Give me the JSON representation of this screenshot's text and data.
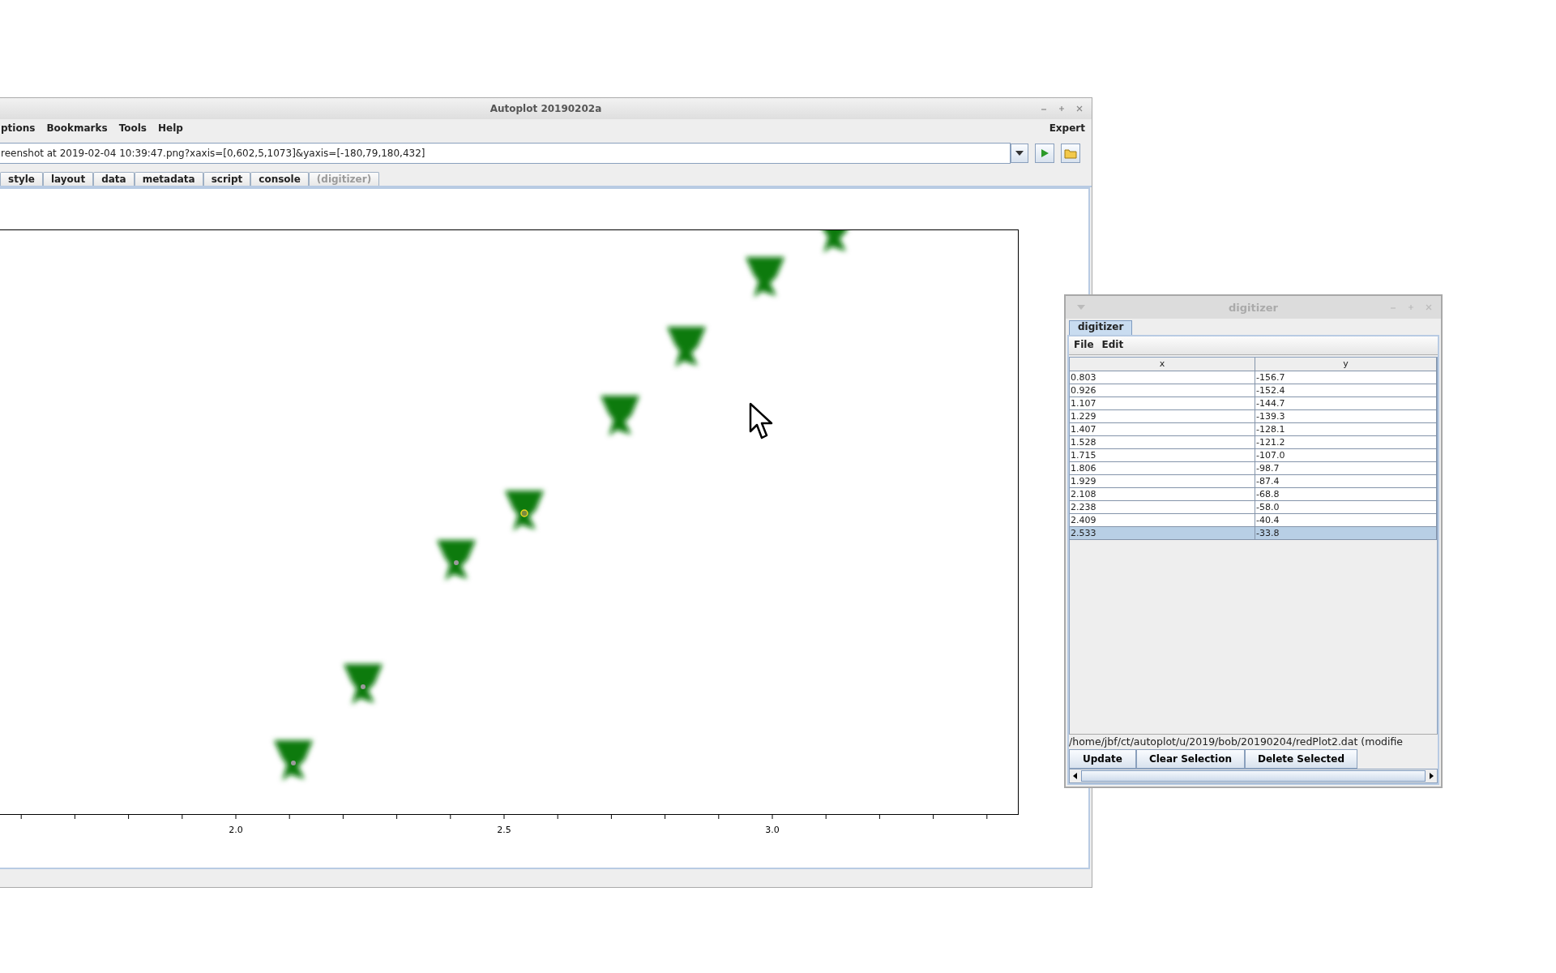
{
  "main_window": {
    "title": "Autoplot 20190202a",
    "menu": [
      "ptions",
      "Bookmarks",
      "Tools",
      "Help"
    ],
    "menu_right": "Expert",
    "uri_field": {
      "value": "reenshot at 2019-02-04 10:39:47.png?xaxis=[0,602,5,1073]&yaxis=[-180,79,180,432]"
    },
    "tabs": [
      {
        "label": "style",
        "selected": false,
        "disabled": false
      },
      {
        "label": "layout",
        "selected": false,
        "disabled": false
      },
      {
        "label": "data",
        "selected": false,
        "disabled": false
      },
      {
        "label": "metadata",
        "selected": false,
        "disabled": false
      },
      {
        "label": "script",
        "selected": false,
        "disabled": false
      },
      {
        "label": "console",
        "selected": false,
        "disabled": false
      },
      {
        "label": "(digitizer)",
        "selected": false,
        "disabled": true
      }
    ],
    "plot": {
      "x_tick_labels": [
        "2.0",
        "2.5",
        "3.0"
      ]
    }
  },
  "digitizer_window": {
    "title": "digitizer",
    "tabs": [
      {
        "label": "digitizer",
        "selected": true
      }
    ],
    "menu": [
      "File",
      "Edit"
    ],
    "table": {
      "columns": [
        "x",
        "y"
      ],
      "rows": [
        {
          "cells": [
            "0.803",
            "-156.7"
          ],
          "selected": false
        },
        {
          "cells": [
            "0.926",
            "-152.4"
          ],
          "selected": false
        },
        {
          "cells": [
            "1.107",
            "-144.7"
          ],
          "selected": false
        },
        {
          "cells": [
            "1.229",
            "-139.3"
          ],
          "selected": false
        },
        {
          "cells": [
            "1.407",
            "-128.1"
          ],
          "selected": false
        },
        {
          "cells": [
            "1.528",
            "-121.2"
          ],
          "selected": false
        },
        {
          "cells": [
            "1.715",
            "-107.0"
          ],
          "selected": false
        },
        {
          "cells": [
            "1.806",
            "-98.7"
          ],
          "selected": false
        },
        {
          "cells": [
            "1.929",
            "-87.4"
          ],
          "selected": false
        },
        {
          "cells": [
            "2.108",
            "-68.8"
          ],
          "selected": false
        },
        {
          "cells": [
            "2.238",
            "-58.0"
          ],
          "selected": false
        },
        {
          "cells": [
            "2.409",
            "-40.4"
          ],
          "selected": false
        },
        {
          "cells": [
            "2.533",
            "-33.8"
          ],
          "selected": true
        }
      ]
    },
    "status": "/home/jbf/ct/autoplot/u/2019/bob/20190204/redPlot2.dat (modifie",
    "buttons": [
      "Update",
      "Clear Selection",
      "Delete Selected"
    ]
  }
}
